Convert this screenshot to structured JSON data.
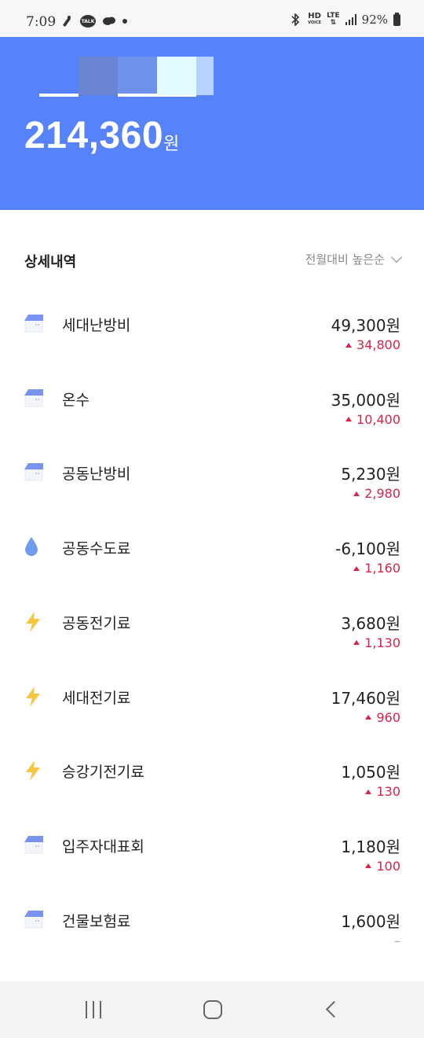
{
  "status_bar": {
    "time": "7:09",
    "talk_label": "TALK",
    "hd_label": "HD",
    "hd_sub": "VOICE",
    "lte_label": "LTE",
    "battery": "92%"
  },
  "header": {
    "total_amount": "214,360",
    "total_unit": "원",
    "background_color": "#5783fa"
  },
  "section": {
    "title": "상세내역",
    "sort_label": "전월대비 높은순"
  },
  "items": [
    {
      "name": "세대난방비",
      "amount": "49,300원",
      "change": "34,800",
      "icon": "house-icon"
    },
    {
      "name": "온수",
      "amount": "35,000원",
      "change": "10,400",
      "icon": "house-icon"
    },
    {
      "name": "공동난방비",
      "amount": "5,230원",
      "change": "2,980",
      "icon": "house-icon"
    },
    {
      "name": "공동수도료",
      "amount": "-6,100원",
      "change": "1,160",
      "icon": "water-drop-icon"
    },
    {
      "name": "공동전기료",
      "amount": "3,680원",
      "change": "1,130",
      "icon": "lightning-icon"
    },
    {
      "name": "세대전기료",
      "amount": "17,460원",
      "change": "960",
      "icon": "lightning-icon"
    },
    {
      "name": "승강기전기료",
      "amount": "1,050원",
      "change": "130",
      "icon": "lightning-icon"
    },
    {
      "name": "입주자대표회",
      "amount": "1,180원",
      "change": "100",
      "icon": "house-icon"
    },
    {
      "name": "건물보험료",
      "amount": "1,600원",
      "change": "–",
      "icon": "house-icon"
    }
  ],
  "colors": {
    "increase": "#d9234a",
    "lightning": "#f7c540",
    "water": "#6f9cf0"
  }
}
